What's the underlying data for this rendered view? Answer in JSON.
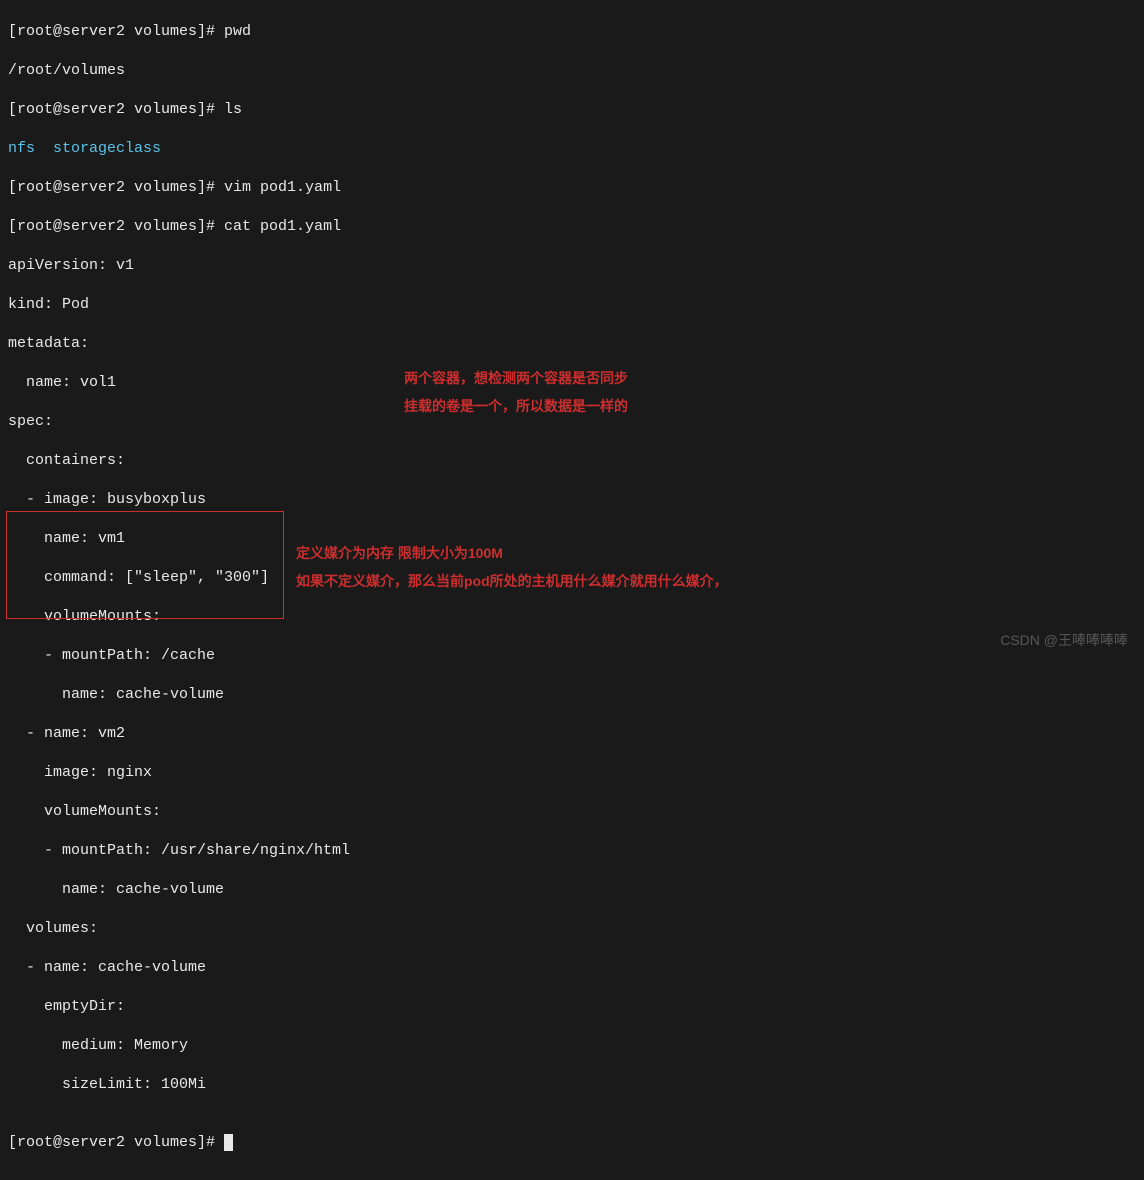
{
  "terminal": {
    "line01_prompt": "[root@server2 volumes]# ",
    "line01_cmd": "pwd",
    "line02": "/root/volumes",
    "line03_prompt": "[root@server2 volumes]# ",
    "line03_cmd": "ls",
    "line04_a": "nfs",
    "line04_b": "  storageclass",
    "line05_prompt": "[root@server2 volumes]# ",
    "line05_cmd": "vim pod1.yaml",
    "line06_prompt": "[root@server2 volumes]# ",
    "line06_cmd": "cat pod1.yaml",
    "yaml01": "apiVersion: v1",
    "yaml02": "kind: Pod",
    "yaml03": "metadata:",
    "yaml04": "  name: vol1",
    "yaml05": "spec:",
    "yaml06": "  containers:",
    "yaml07": "  - image: busyboxplus",
    "yaml08": "    name: vm1",
    "yaml09": "    command: [\"sleep\", \"300\"]",
    "yaml10": "    volumeMounts:",
    "yaml11": "    - mountPath: /cache",
    "yaml12": "      name: cache-volume",
    "yaml13": "  - name: vm2",
    "yaml14": "    image: nginx",
    "yaml15": "    volumeMounts:",
    "yaml16": "    - mountPath: /usr/share/nginx/html",
    "yaml17": "      name: cache-volume",
    "yaml18": "  volumes:",
    "yaml19": "  - name: cache-volume",
    "yaml20": "    emptyDir:",
    "yaml21": "      medium: Memory",
    "yaml22": "      sizeLimit: 100Mi",
    "blank": "",
    "lineEnd_prompt": "[root@server2 volumes]# "
  },
  "annotations": {
    "a1": "两个容器，想检测两个容器是否同步",
    "a2": "挂载的卷是一个，所以数据是一样的",
    "a3": "定义媒介为内存  限制大小为100M",
    "a4": "如果不定义媒介，那么当前pod所处的主机用什么媒介就用什么媒介，"
  },
  "watermark": "CSDN @王唪唪唪唪"
}
